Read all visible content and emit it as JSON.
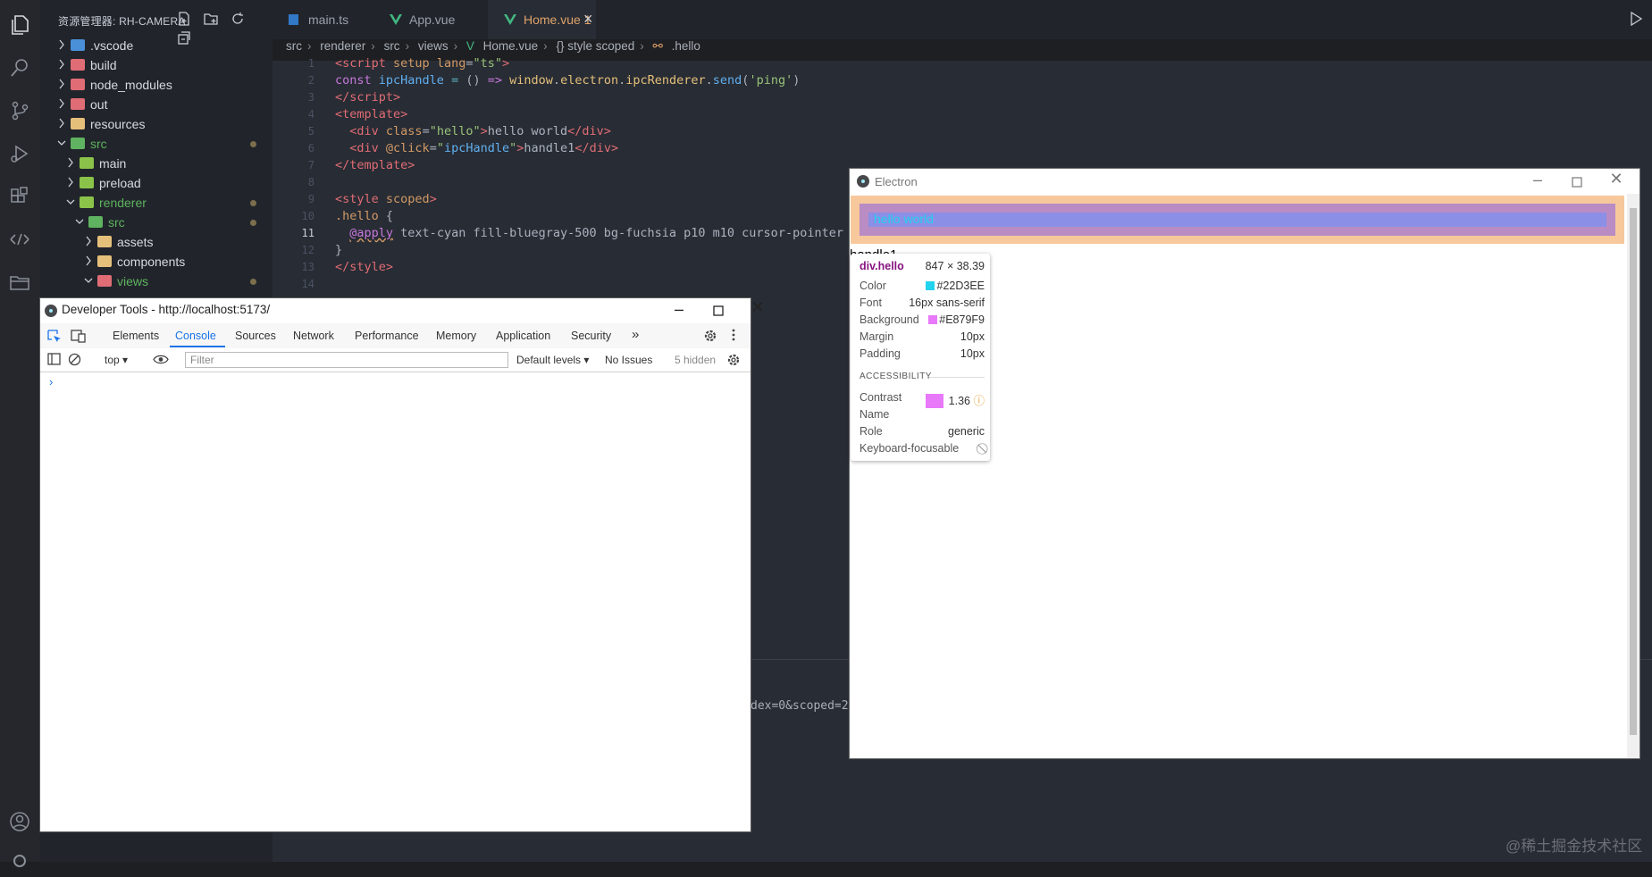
{
  "colors": {
    "accent_orange": "#e0a36a",
    "vue_green": "#42b883",
    "hello_color": "#22D3EE",
    "hello_bg": "#E879F9"
  },
  "sidebar": {
    "title": "资源管理器: RH-CAMERA",
    "tree": [
      {
        "label": ".vscode",
        "icon": "folder-vscode-icon"
      },
      {
        "label": "build",
        "icon": "folder-build-icon"
      },
      {
        "label": "node_modules",
        "icon": "folder-node-icon"
      },
      {
        "label": "out",
        "icon": "folder-out-icon"
      },
      {
        "label": "resources",
        "icon": "folder-icon"
      },
      {
        "label": "src",
        "icon": "folder-src-icon"
      },
      {
        "label": "main",
        "icon": "folder-icon"
      },
      {
        "label": "preload",
        "icon": "folder-icon"
      },
      {
        "label": "renderer",
        "icon": "folder-icon"
      },
      {
        "label": "src",
        "icon": "folder-src-icon"
      },
      {
        "label": "assets",
        "icon": "folder-icon"
      },
      {
        "label": "components",
        "icon": "folder-icon"
      },
      {
        "label": "views",
        "icon": "folder-views-icon"
      }
    ]
  },
  "tabs": [
    {
      "label": "main.ts"
    },
    {
      "label": "App.vue"
    },
    {
      "label": "Home.vue 1"
    }
  ],
  "breadcrumb": [
    "src",
    "renderer",
    "src",
    "views",
    "Home.vue",
    "{} style scoped",
    ".hello"
  ],
  "code": {
    "line_numbers": [
      "1",
      "2",
      "3",
      "4",
      "5",
      "6",
      "7",
      "8",
      "9",
      "10",
      "11",
      "12",
      "13",
      "14"
    ],
    "tail": "dex=0&scoped=2"
  },
  "devtools": {
    "title": "Developer Tools - http://localhost:5173/",
    "tabs": [
      "Elements",
      "Console",
      "Sources",
      "Network",
      "Performance",
      "Memory",
      "Application",
      "Security",
      "»"
    ],
    "context": "top",
    "filter_placeholder": "Filter",
    "levels": "Default levels",
    "issues": "No Issues",
    "hidden": "5 hidden",
    "prompt": "›"
  },
  "electron": {
    "title": "Electron",
    "hello_text": "hello world",
    "handle_text": "handle1"
  },
  "tooltip": {
    "selector": "div.hello",
    "size": "847 × 38.39",
    "color_label": "Color",
    "color_value": "#22D3EE",
    "font_label": "Font",
    "font_value": "16px sans-serif",
    "background_label": "Background",
    "background_value": "#E879F9",
    "margin_label": "Margin",
    "margin_value": "10px",
    "padding_label": "Padding",
    "padding_value": "10px",
    "accessibility_heading": "ACCESSIBILITY",
    "contrast_label": "Contrast",
    "contrast_value": "1.36",
    "name_label": "Name",
    "role_label": "Role",
    "role_value": "generic",
    "keyboard_label": "Keyboard-focusable"
  },
  "watermark": "@稀土掘金技术社区"
}
